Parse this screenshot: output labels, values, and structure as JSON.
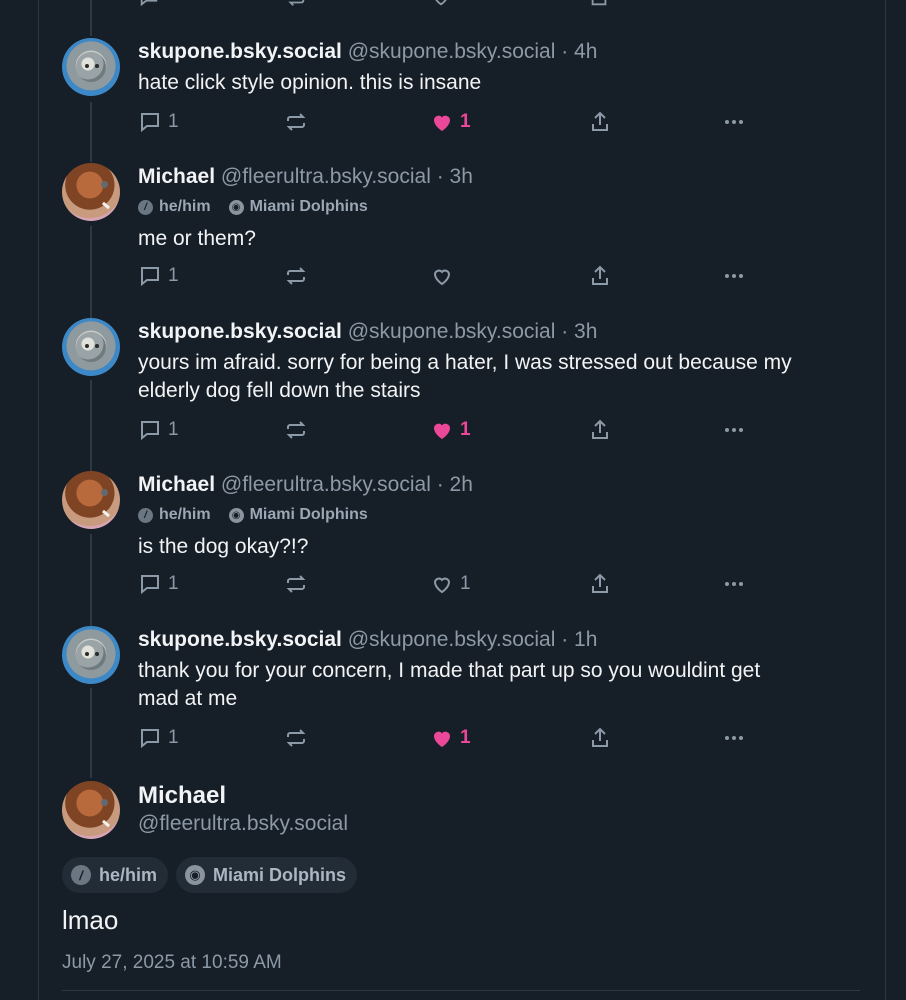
{
  "thread": [
    {
      "id": "p1",
      "avatar": "seal-avatar",
      "display_name": "skupone.bsky.social",
      "handle_time": "@skupone.bsky.social · 4h",
      "badges": [],
      "text": "hate click style opinion. this is insane",
      "replies": "1",
      "likes": "1",
      "liked": true
    },
    {
      "id": "p2",
      "avatar": "dog-avatar",
      "display_name": "Michael",
      "handle_time": "@fleerultra.bsky.social · 3h",
      "badges": [
        "he/him",
        "Miami Dolphins"
      ],
      "text": "me or them?",
      "replies": "1",
      "likes": "",
      "liked": false
    },
    {
      "id": "p3",
      "avatar": "seal-avatar",
      "display_name": "skupone.bsky.social",
      "handle_time": "@skupone.bsky.social · 3h",
      "badges": [],
      "text_lines": [
        "yours im afraid. sorry for being a hater, I was stressed out because my",
        "elderly dog fell down the stairs"
      ],
      "replies": "1",
      "likes": "1",
      "liked": true
    },
    {
      "id": "p4",
      "avatar": "dog-avatar",
      "display_name": "Michael",
      "handle_time": "@fleerultra.bsky.social · 2h",
      "badges": [
        "he/him",
        "Miami Dolphins"
      ],
      "text": "is the dog okay?!?",
      "replies": "1",
      "likes": "1",
      "liked": false
    },
    {
      "id": "p5",
      "avatar": "seal-avatar",
      "display_name": "skupone.bsky.social",
      "handle_time": "@skupone.bsky.social · 1h",
      "badges": [],
      "text_lines": [
        "thank you for your concern, I made that part up so you wouldint get",
        "mad at me"
      ],
      "replies": "1",
      "likes": "1",
      "liked": true
    }
  ],
  "main_post": {
    "display_name": "Michael",
    "handle": "@fleerultra.bsky.social",
    "pronouns": "he/him",
    "team": "Miami Dolphins",
    "text": "lmao",
    "timestamp": "July 27, 2025 at 10:59 AM"
  },
  "colors": {
    "background": "#161e27",
    "muted": "#8c99a6",
    "like_pink": "#ec4899",
    "border": "#2e3843"
  }
}
